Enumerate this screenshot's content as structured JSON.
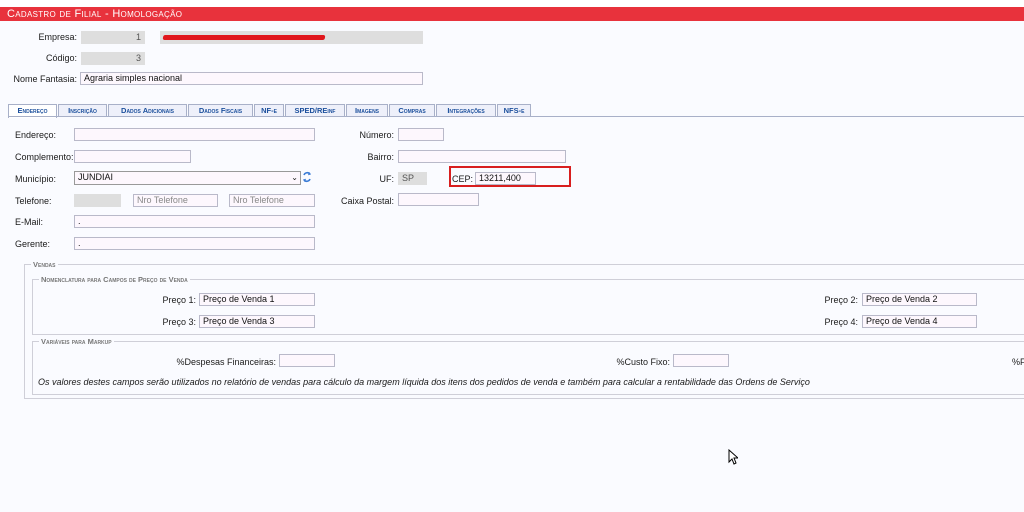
{
  "title": "Cadastro de Filial - Homologação",
  "header": {
    "empresa_label": "Empresa:",
    "empresa_value": "1",
    "codigo_label": "Código:",
    "codigo_value": "3",
    "nome_fantasia_label": "Nome Fantasia:",
    "nome_fantasia_value": "Agraria simples nacional"
  },
  "tabs": [
    "Endereço",
    "Inscrição",
    "Dados Adicionais",
    "Dados Fiscais",
    "NF-e",
    "SPED/REinf",
    "Imagens",
    "Compras",
    "Integrações",
    "NFS-e"
  ],
  "form": {
    "endereco_label": "Endereço:",
    "endereco_value": "",
    "numero_label": "Número:",
    "numero_value": "",
    "complemento_label": "Complemento:",
    "complemento_value": "",
    "bairro_label": "Bairro:",
    "bairro_value": "",
    "municipio_label": "Município:",
    "municipio_value": "JUNDIAI",
    "uf_label": "UF:",
    "uf_value": "SP",
    "cep_label": "CEP:",
    "cep_value": "13211,400",
    "telefone_label": "Telefone:",
    "telefone_placeholder_1": "Nro Telefone",
    "telefone_placeholder_2": "Nro Telefone",
    "caixa_postal_label": "Caixa Postal:",
    "email_label": "E-Mail:",
    "email_value": ".",
    "gerente_label": "Gerente:",
    "gerente_value": "."
  },
  "vendas": {
    "legend": "Vendas",
    "nomenclatura_legend": "Nomenclatura para Campos de Preço de Venda",
    "preco1_label": "Preço 1:",
    "preco1_value": "Preço de Venda 1",
    "preco2_label": "Preço 2:",
    "preco2_value": "Preço de Venda 2",
    "preco3_label": "Preço 3:",
    "preco3_value": "Preço de Venda 3",
    "preco4_label": "Preço 4:",
    "preco4_value": "Preço de Venda 4",
    "markup_legend": "Variáveis para Markup",
    "despesas_label": "%Despesas Financeiras:",
    "custo_fixo_label": "%Custo Fixo:",
    "cut_label": "%F",
    "note": "Os valores destes campos serão utilizados no relatório de vendas para cálculo da margem líquida dos itens dos pedidos de venda e também para calcular a rentabilidade das Ordens de Serviço"
  },
  "colors": {
    "title_bar": "#e8323c",
    "tab_text": "#1b4f9c",
    "highlight": "#d81e1e"
  },
  "icons": [
    "refresh-icon",
    "chevron-down-icon",
    "mouse-cursor-icon"
  ]
}
